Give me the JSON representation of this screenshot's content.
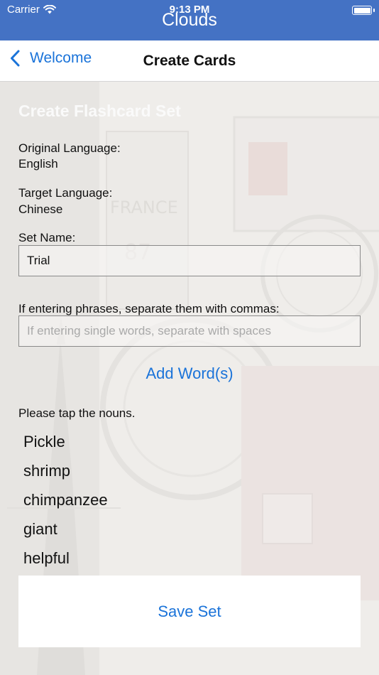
{
  "status_bar": {
    "carrier": "Carrier",
    "time": "9:13 PM",
    "app_title": "Clouds"
  },
  "nav": {
    "back_label": "Welcome",
    "title": "Create Cards"
  },
  "form": {
    "heading": "Create Flashcard Set",
    "original_language_label": "Original Language:",
    "original_language_value": "English",
    "target_language_label": "Target Language:",
    "target_language_value": "Chinese",
    "set_name_label": "Set Name:",
    "set_name_value": "Trial",
    "phrases_label": "If entering phrases, separate them with commas:",
    "words_placeholder": "If entering single words, separate with spaces",
    "add_button": "Add Word(s)",
    "nouns_prompt": "Please tap the nouns.",
    "words": [
      "Pickle",
      "shrimp",
      "chimpanzee",
      "giant",
      "helpful"
    ],
    "save_button": "Save Set"
  },
  "colors": {
    "status_bar": "#4472c4",
    "accent": "#1a73d9"
  }
}
